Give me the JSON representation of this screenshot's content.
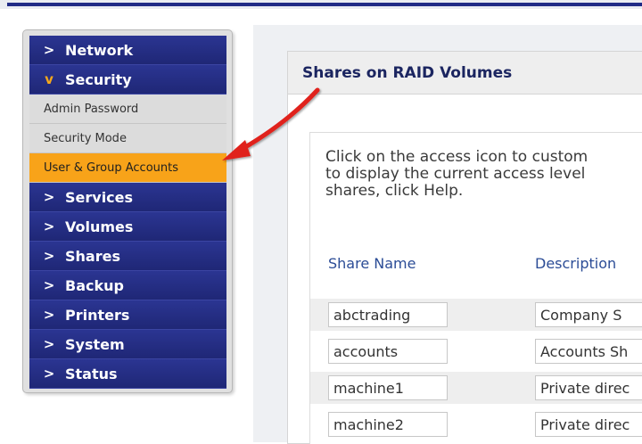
{
  "sidebar": {
    "items": [
      {
        "label": "Network"
      },
      {
        "label": "Security"
      },
      {
        "label": "Services"
      },
      {
        "label": "Volumes"
      },
      {
        "label": "Shares"
      },
      {
        "label": "Backup"
      },
      {
        "label": "Printers"
      },
      {
        "label": "System"
      },
      {
        "label": "Status"
      }
    ],
    "security_subitems": [
      {
        "label": "Admin Password"
      },
      {
        "label": "Security Mode"
      },
      {
        "label": "User & Group Accounts"
      }
    ]
  },
  "icons": {
    "collapsed": "chevron-right-icon",
    "expanded": "chevron-down-icon",
    "annotation": "red-arrow"
  },
  "colors": {
    "nav_bg": "#252e85",
    "selected_bg": "#f8a319",
    "arrow": "#e0201b",
    "title": "#1b2560",
    "link": "#2b4c96"
  },
  "panel": {
    "title": "Shares on RAID Volumes",
    "help_lines": [
      "Click on the access icon to custom",
      "to display the current access level",
      "shares, click Help."
    ],
    "columns": {
      "share_name": "Share Name",
      "description": "Description"
    },
    "rows": [
      {
        "name": "abctrading",
        "description": "Company S"
      },
      {
        "name": "accounts",
        "description": "Accounts Sh"
      },
      {
        "name": "machine1",
        "description": "Private direc"
      },
      {
        "name": "machine2",
        "description": "Private direc"
      }
    ]
  }
}
